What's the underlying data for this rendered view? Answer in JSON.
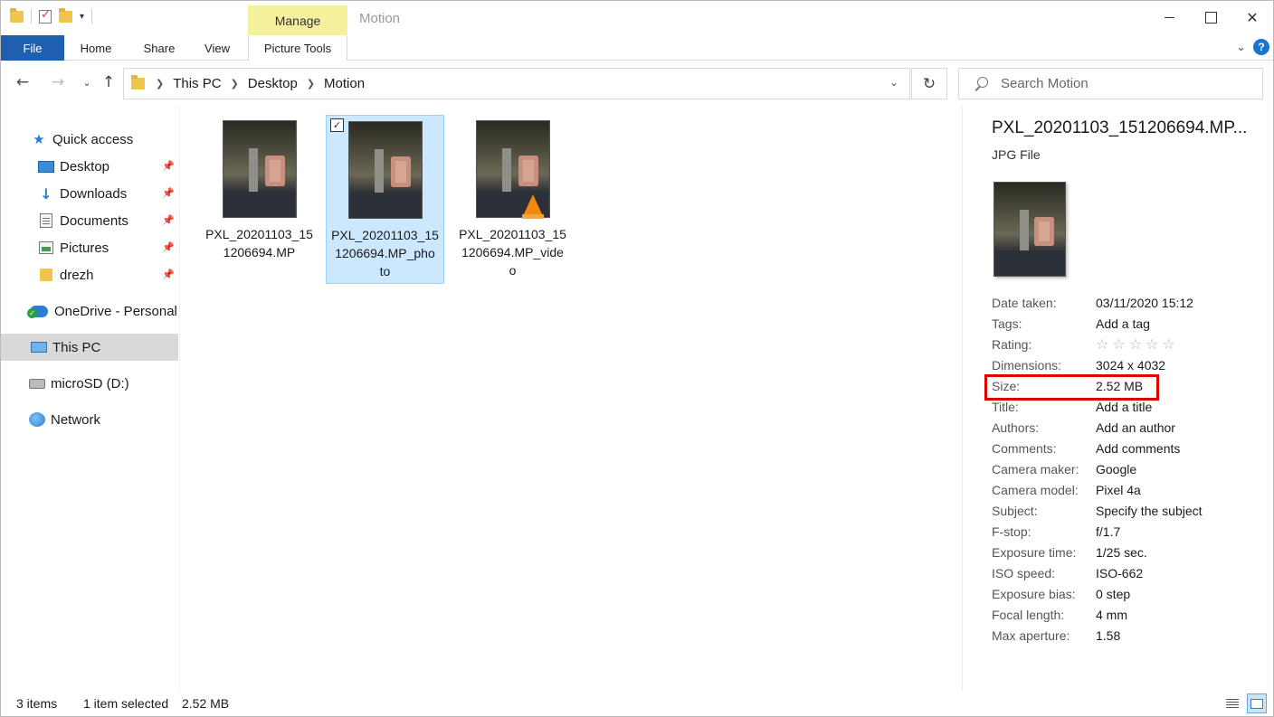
{
  "window": {
    "title": "Motion",
    "manage_tab": "Manage",
    "minimize": "",
    "maximize": "",
    "close": "✕"
  },
  "ribbon": {
    "tabs": [
      "File",
      "Home",
      "Share",
      "View",
      "Picture Tools"
    ]
  },
  "address": {
    "crumbs": [
      "This PC",
      "Desktop",
      "Motion"
    ],
    "search_placeholder": "Search Motion"
  },
  "sidebar": {
    "items": [
      {
        "label": "Quick access",
        "icon": "star-icon"
      },
      {
        "label": "Desktop",
        "icon": "desktop-icon",
        "pinned": true
      },
      {
        "label": "Downloads",
        "icon": "download-arrow-icon",
        "pinned": true
      },
      {
        "label": "Documents",
        "icon": "documents-icon",
        "pinned": true
      },
      {
        "label": "Pictures",
        "icon": "pictures-icon",
        "pinned": true
      },
      {
        "label": "drezh",
        "icon": "folder-icon",
        "pinned": true
      },
      {
        "label": "OneDrive - Personal",
        "icon": "onedrive-cloud-icon"
      },
      {
        "label": "This PC",
        "icon": "computer-icon",
        "selected": true
      },
      {
        "label": "microSD (D:)",
        "icon": "drive-icon"
      },
      {
        "label": "Network",
        "icon": "network-icon"
      }
    ]
  },
  "files": [
    {
      "name": "PXL_20201103_151206694.MP",
      "selected": false,
      "overlay": ""
    },
    {
      "name": "PXL_20201103_151206694.MP_photo",
      "selected": true,
      "overlay": ""
    },
    {
      "name": "PXL_20201103_151206694.MP_video",
      "selected": false,
      "overlay": "vlc-cone-icon"
    }
  ],
  "file_labels": {
    "f0": "PXL_20201103_15\n1206694.MP",
    "f1": "PXL_20201103_15\n1206694.MP_pho\nto",
    "f2": "PXL_20201103_15\n1206694.MP_vide\no"
  },
  "details": {
    "title": "PXL_20201103_151206694.MP...",
    "type": "JPG File",
    "props": [
      {
        "label": "Date taken:",
        "value": "03/11/2020 15:12"
      },
      {
        "label": "Tags:",
        "value": "Add a tag"
      },
      {
        "label": "Rating:",
        "value": "☆☆☆☆☆"
      },
      {
        "label": "Dimensions:",
        "value": "3024 x 4032"
      },
      {
        "label": "Size:",
        "value": "2.52 MB"
      },
      {
        "label": "Title:",
        "value": "Add a title"
      },
      {
        "label": "Authors:",
        "value": "Add an author"
      },
      {
        "label": "Comments:",
        "value": "Add comments"
      },
      {
        "label": "Camera maker:",
        "value": "Google"
      },
      {
        "label": "Camera model:",
        "value": "Pixel 4a"
      },
      {
        "label": "Subject:",
        "value": "Specify the subject"
      },
      {
        "label": "F-stop:",
        "value": "f/1.7"
      },
      {
        "label": "Exposure time:",
        "value": "1/25 sec."
      },
      {
        "label": "ISO speed:",
        "value": "ISO-662"
      },
      {
        "label": "Exposure bias:",
        "value": "0 step"
      },
      {
        "label": "Focal length:",
        "value": "4 mm"
      },
      {
        "label": "Max aperture:",
        "value": "1.58"
      }
    ]
  },
  "status": {
    "count": "3 items",
    "selected": "1 item selected",
    "size": "2.52 MB"
  },
  "colors": {
    "accent": "#1f5fb0",
    "manage_tab": "#f4f09e",
    "selection": "#cce8ff",
    "highlight": "#e10000"
  }
}
